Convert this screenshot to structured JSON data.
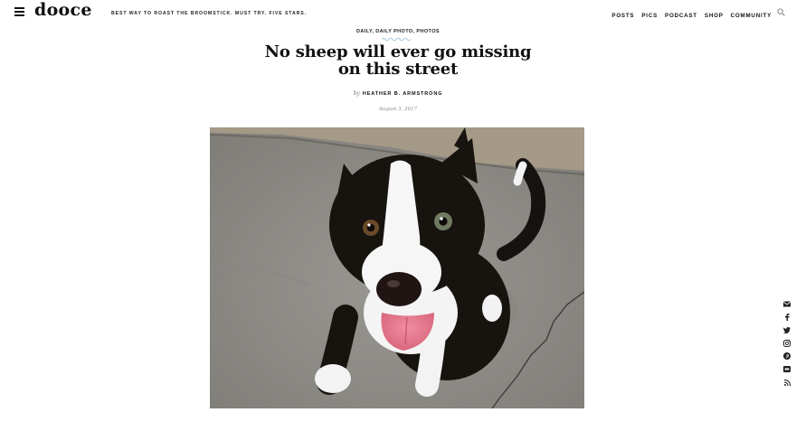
{
  "header": {
    "logo": "dooce",
    "tagline": "BEST WAY TO ROAST THE BROOMSTICK. MUST TRY. FIVE STARS.",
    "nav": [
      "POSTS",
      "PICS",
      "PODCAST",
      "SHOP",
      "COMMUNITY"
    ]
  },
  "post": {
    "categories": [
      "DAILY",
      "DAILY PHOTO",
      "PHOTOS"
    ],
    "category_separator": ", ",
    "title": "No sheep will ever go missing on this street",
    "by": "by",
    "author": "HEATHER B. ARMSTRONG",
    "date": "August 3, 2017"
  },
  "social_icons": [
    "email-icon",
    "facebook-icon",
    "twitter-icon",
    "instagram-icon",
    "pinterest-icon",
    "flickr-icon",
    "rss-icon"
  ],
  "colors": {
    "text": "#111111",
    "accent_wave": "#9cc7e0",
    "muted": "#888888"
  }
}
